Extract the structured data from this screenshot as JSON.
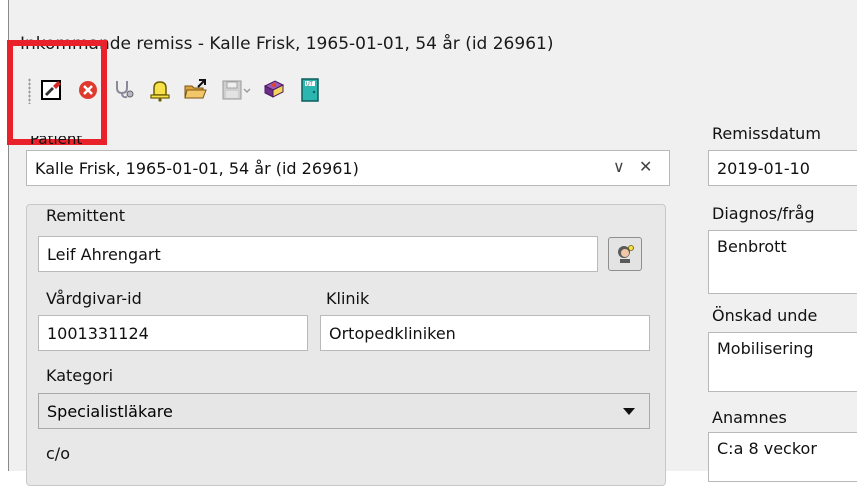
{
  "window": {
    "title": "Inkommande remiss - Kalle Frisk, 1965-01-01, 54 år (id 26961)"
  },
  "toolbar": {
    "icons": [
      "sign-icon",
      "cancel-icon",
      "stethoscope-icon",
      "alarm-bell-icon",
      "open-folder-icon",
      "save-icon",
      "book-icon",
      "exit-door-icon"
    ]
  },
  "patient": {
    "label": "Patient",
    "value": "Kalle Frisk, 1965-01-01, 54 år (id 26961)",
    "chevron": "∨",
    "clear": "✕"
  },
  "remittent": {
    "group_label": "Remittent",
    "name": "Leif Ahrengart",
    "vardgivar_label": "Vårdgivar-id",
    "vardgivar_value": "1001331124",
    "klinik_label": "Klinik",
    "klinik_value": "Ortopedkliniken",
    "kategori_label": "Kategori",
    "kategori_value": "Specialistläkare",
    "co_label": "c/o"
  },
  "right": {
    "remissdatum_label": "Remissdatum",
    "remissdatum_value": "2019-01-10",
    "diagnos_label": "Diagnos/fråg",
    "diagnos_value": "Benbrott",
    "onskad_label": "Önskad unde",
    "onskad_value": "Mobilisering",
    "anamnes_label": "Anamnes",
    "anamnes_value": "C:a 8 veckor"
  },
  "colors": {
    "highlight": "#e8212b",
    "window_bg": "#f0f0f0"
  }
}
